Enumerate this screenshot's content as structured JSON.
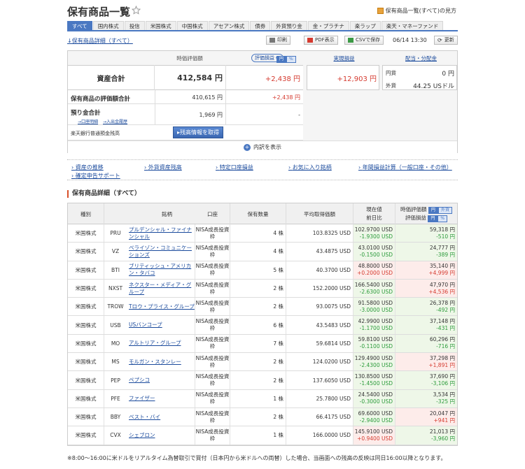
{
  "header": {
    "title": "保有商品一覧",
    "view_all_link": "保有商品一覧(すべて)の見方"
  },
  "tabs": [
    "すべて",
    "国内株式",
    "投信",
    "米国株式",
    "中国株式",
    "アセアン株式",
    "債券",
    "外貨預り金",
    "金・プラチナ",
    "楽ラップ",
    "楽天・マネーファンド"
  ],
  "toolbar": {
    "detail_link": "↓保有商品詳細（すべて）",
    "print": "印刷",
    "pdf": "PDF表示",
    "csv": "CSVで保存",
    "timestamp": "06/14 13:30",
    "refresh": "更新"
  },
  "summary": {
    "col_valuation": "時価評価額",
    "col_unrealized": "評価損益",
    "currency_yen": "円",
    "currency_pct": "%",
    "col_realized": "実現損益",
    "col_dividend": "配当・分配金",
    "total_label": "資産合計",
    "total_value": "412,584 円",
    "total_gain": "+2,438 円",
    "realized_value": "+12,903 円",
    "div_yen_label": "円貨",
    "div_yen_value": "0 円",
    "div_fx_label": "外貨",
    "div_fx_value": "44.25 USドル",
    "holdings_label": "保有商品の評価額合計",
    "holdings_value": "410,615 円",
    "holdings_gain": "+2,438 円",
    "deposit_label": "預り金合計",
    "deposit_value": "1,969 円",
    "deposit_gain": "-",
    "deposit_link1": "→口座明細",
    "deposit_link2": "→入出金履歴",
    "bank_label": "楽天銀行普通預金残高",
    "bank_button": "残高情報を取得",
    "breakdown": "内訳を表示"
  },
  "links": [
    "資産の推移",
    "外貨資産残高",
    "特定口座損益",
    "お気に入り銘柄",
    "年間損益計算（一般口座・その他）",
    "確定申告サポート"
  ],
  "holdings": {
    "title": "保有商品詳細（すべて）",
    "headers": {
      "type": "種別",
      "name": "銘柄",
      "account": "口座",
      "qty": "保有数量",
      "avg": "平均取得価額",
      "price1": "現在値",
      "price2": "前日比",
      "val1": "時価評価額",
      "val2": "評価損益",
      "yen": "円",
      "fx": "外貨",
      "pct": "%"
    },
    "rows": [
      {
        "type": "米国株式",
        "ticker": "PRU",
        "name": "プルデンシャル・ファイナンシャル",
        "account": "NISA成長投資枠",
        "qty": "4 株",
        "avg": "103.8325 USD",
        "price": "102.9700 USD",
        "chg": "-1.9300 USD",
        "val": "59,318 円",
        "gain": "-510 円",
        "neg": true
      },
      {
        "type": "米国株式",
        "ticker": "VZ",
        "name": "ベライゾン・コミュニケーションズ",
        "account": "NISA成長投資枠",
        "qty": "4 株",
        "avg": "43.4875 USD",
        "price": "43.0100 USD",
        "chg": "-0.1500 USD",
        "val": "24,777 円",
        "gain": "-389 円",
        "neg": true
      },
      {
        "type": "米国株式",
        "ticker": "BTI",
        "name": "ブリティッシュ・アメリカン・タバコ",
        "account": "NISA成長投資枠",
        "qty": "5 株",
        "avg": "40.3700 USD",
        "price": "48.8000 USD",
        "chg": "+0.2000 USD",
        "val": "35,140 円",
        "gain": "+4,999 円",
        "neg": false
      },
      {
        "type": "米国株式",
        "ticker": "NXST",
        "name": "ネクスター・メディア・グループ",
        "account": "NISA成長投資枠",
        "qty": "2 株",
        "avg": "152.2000 USD",
        "price": "166.5400 USD",
        "chg": "-2.6300 USD",
        "val": "47,970 円",
        "gain": "+4,536 円",
        "neg": false
      },
      {
        "type": "米国株式",
        "ticker": "TROW",
        "name": "Tロウ・プライス・グループ",
        "account": "NISA成長投資枠",
        "qty": "2 株",
        "avg": "93.0075 USD",
        "price": "91.5800 USD",
        "chg": "-3.0000 USD",
        "val": "26,378 円",
        "gain": "-492 円",
        "neg": true
      },
      {
        "type": "米国株式",
        "ticker": "USB",
        "name": "USバンコープ",
        "account": "NISA成長投資枠",
        "qty": "6 株",
        "avg": "43.5483 USD",
        "price": "42.9900 USD",
        "chg": "-1.1700 USD",
        "val": "37,148 円",
        "gain": "-431 円",
        "neg": true
      },
      {
        "type": "米国株式",
        "ticker": "MO",
        "name": "アルトリア・グループ",
        "account": "NISA成長投資枠",
        "qty": "7 株",
        "avg": "59.6814 USD",
        "price": "59.8100 USD",
        "chg": "-0.1100 USD",
        "val": "60,296 円",
        "gain": "-716 円",
        "neg": true
      },
      {
        "type": "米国株式",
        "ticker": "MS",
        "name": "モルガン・スタンレー",
        "account": "NISA成長投資枠",
        "qty": "2 株",
        "avg": "124.0200 USD",
        "price": "129.4900 USD",
        "chg": "-2.4300 USD",
        "val": "37,298 円",
        "gain": "+1,891 円",
        "neg": false
      },
      {
        "type": "米国株式",
        "ticker": "PEP",
        "name": "ペプシコ",
        "account": "NISA成長投資枠",
        "qty": "2 株",
        "avg": "137.6050 USD",
        "price": "130.8500 USD",
        "chg": "-1.4500 USD",
        "val": "37,690 円",
        "gain": "-3,106 円",
        "neg": true
      },
      {
        "type": "米国株式",
        "ticker": "PFE",
        "name": "ファイザー",
        "account": "NISA成長投資枠",
        "qty": "1 株",
        "avg": "25.7800 USD",
        "price": "24.5400 USD",
        "chg": "-0.3000 USD",
        "val": "3,534 円",
        "gain": "-325 円",
        "neg": true
      },
      {
        "type": "米国株式",
        "ticker": "BBY",
        "name": "ベスト・バイ",
        "account": "NISA成長投資枠",
        "qty": "2 株",
        "avg": "66.4175 USD",
        "price": "69.6000 USD",
        "chg": "-2.9400 USD",
        "val": "20,047 円",
        "gain": "+941 円",
        "neg": false
      },
      {
        "type": "米国株式",
        "ticker": "CVX",
        "name": "シェブロン",
        "account": "NISA成長投資枠",
        "qty": "1 株",
        "avg": "166.0000 USD",
        "price": "145.9100 USD",
        "chg": "+0.9400 USD",
        "val": "21,013 円",
        "gain": "-3,960 円",
        "neg": true
      }
    ]
  },
  "footnote": "※8:00～16:00に米ドルをリアルタイム為替取引で買付（日本円から米ドルへの両替）した場合、当画面への残高の反映は同日16:00以降となります。",
  "colors": {
    "accent": "#4a78c2",
    "gain": "#d53a2f",
    "loss": "#2b9b3a"
  }
}
